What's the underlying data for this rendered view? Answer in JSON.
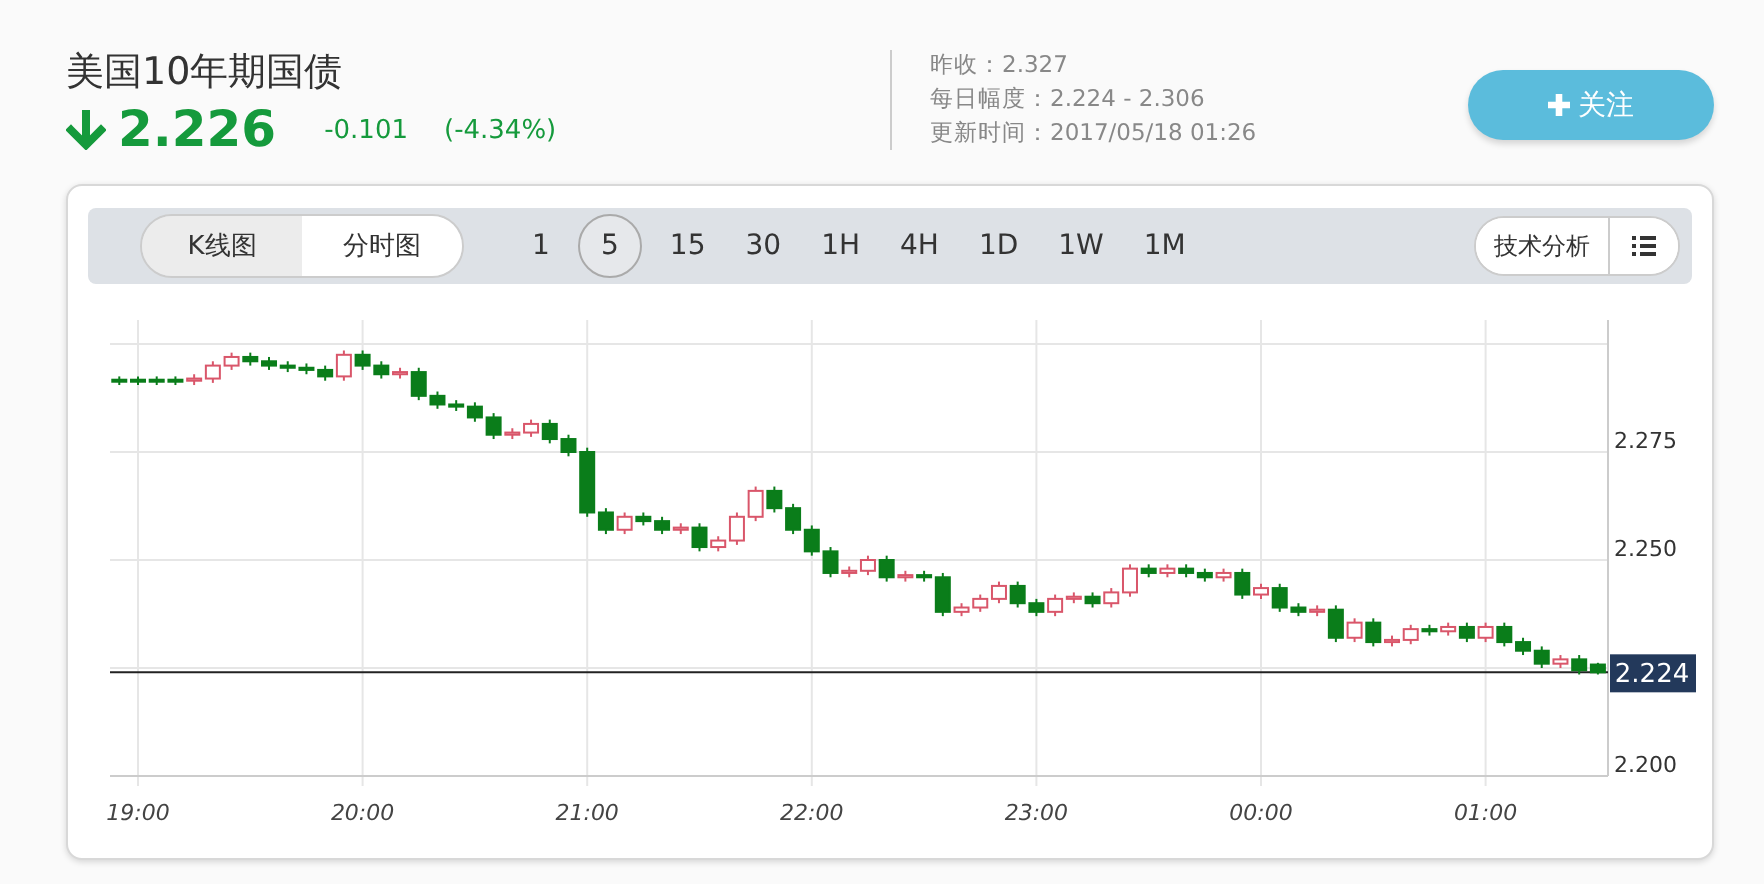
{
  "instrument": {
    "title": "美国10年期国债",
    "falling": true,
    "price": "2.226",
    "change": "-0.101",
    "change_percent": "(-4.34%)"
  },
  "stats": [
    "昨收：2.327",
    "每日幅度：2.224 - 2.306",
    "更新时间：2017/05/18 01:26"
  ],
  "follow_button": {
    "label": "关注"
  },
  "chart_types": [
    {
      "label": "K线图",
      "selected": true
    },
    {
      "label": "分时图",
      "selected": false
    }
  ],
  "periods": [
    {
      "label": "1",
      "selected": false
    },
    {
      "label": "5",
      "selected": true
    },
    {
      "label": "15",
      "selected": false
    },
    {
      "label": "30",
      "selected": false
    },
    {
      "label": "1H",
      "selected": false
    },
    {
      "label": "4H",
      "selected": false
    },
    {
      "label": "1D",
      "selected": false
    },
    {
      "label": "1W",
      "selected": false
    },
    {
      "label": "1M",
      "selected": false
    }
  ],
  "analysis_button": {
    "label": "技术分析"
  },
  "chart": {
    "chart_data": {
      "type": "candlestick",
      "grid": true,
      "categories": [
        null,
        "19:00",
        null,
        null,
        null,
        null,
        null,
        null,
        null,
        null,
        null,
        null,
        null,
        "20:00",
        null,
        null,
        null,
        null,
        null,
        null,
        null,
        null,
        null,
        null,
        null,
        "21:00",
        null,
        null,
        null,
        null,
        null,
        null,
        null,
        null,
        null,
        null,
        null,
        "22:00",
        null,
        null,
        null,
        null,
        null,
        null,
        null,
        null,
        null,
        null,
        null,
        "23:00",
        null,
        null,
        null,
        null,
        null,
        null,
        null,
        null,
        null,
        null,
        null,
        "00:00",
        null,
        null,
        null,
        null,
        null,
        null,
        null,
        null,
        null,
        null,
        null,
        "01:00",
        null,
        null,
        null,
        null,
        null,
        null
      ],
      "ohlc": [
        [
          2.2915,
          2.2925,
          2.2905,
          2.2915
        ],
        [
          2.2915,
          2.2925,
          2.2905,
          2.2915
        ],
        [
          2.2915,
          2.2925,
          2.2905,
          2.2915
        ],
        [
          2.2915,
          2.2925,
          2.2905,
          2.2915
        ],
        [
          2.2915,
          2.293,
          2.2905,
          2.292
        ],
        [
          2.292,
          2.296,
          2.291,
          2.295
        ],
        [
          2.295,
          2.298,
          2.294,
          2.297
        ],
        [
          2.297,
          2.298,
          2.295,
          2.296
        ],
        [
          2.296,
          2.297,
          2.294,
          2.295
        ],
        [
          2.295,
          2.296,
          2.2935,
          2.2945
        ],
        [
          2.2945,
          2.2955,
          2.293,
          2.294
        ],
        [
          2.294,
          2.295,
          2.2915,
          2.2925
        ],
        [
          2.2925,
          2.2985,
          2.2915,
          2.2975
        ],
        [
          2.2975,
          2.2985,
          2.294,
          2.295
        ],
        [
          2.295,
          2.296,
          2.292,
          2.293
        ],
        [
          2.293,
          2.2945,
          2.292,
          2.2935
        ],
        [
          2.2935,
          2.2945,
          2.287,
          2.288
        ],
        [
          2.288,
          2.289,
          2.285,
          2.286
        ],
        [
          2.286,
          2.287,
          2.2845,
          2.2855
        ],
        [
          2.2855,
          2.2865,
          2.282,
          2.283
        ],
        [
          2.283,
          2.284,
          2.278,
          2.279
        ],
        [
          2.279,
          2.2805,
          2.278,
          2.2795
        ],
        [
          2.2795,
          2.2825,
          2.2785,
          2.2815
        ],
        [
          2.2815,
          2.2825,
          2.277,
          2.278
        ],
        [
          2.278,
          2.279,
          2.274,
          2.275
        ],
        [
          2.275,
          2.276,
          2.26,
          2.261
        ],
        [
          2.261,
          2.262,
          2.256,
          2.257
        ],
        [
          2.257,
          2.261,
          2.256,
          2.26
        ],
        [
          2.26,
          2.261,
          2.258,
          2.259
        ],
        [
          2.259,
          2.26,
          2.256,
          2.257
        ],
        [
          2.257,
          2.2585,
          2.256,
          2.2575
        ],
        [
          2.2575,
          2.2585,
          2.252,
          2.253
        ],
        [
          2.253,
          2.2555,
          2.252,
          2.2545
        ],
        [
          2.2545,
          2.261,
          2.2535,
          2.26
        ],
        [
          2.26,
          2.267,
          2.259,
          2.266
        ],
        [
          2.266,
          2.267,
          2.261,
          2.262
        ],
        [
          2.262,
          2.263,
          2.256,
          2.257
        ],
        [
          2.257,
          2.258,
          2.251,
          2.252
        ],
        [
          2.252,
          2.253,
          2.246,
          2.247
        ],
        [
          2.247,
          2.2485,
          2.246,
          2.2475
        ],
        [
          2.2475,
          2.251,
          2.2465,
          2.25
        ],
        [
          2.25,
          2.251,
          2.245,
          2.246
        ],
        [
          2.246,
          2.2475,
          2.245,
          2.2465
        ],
        [
          2.2465,
          2.2475,
          2.245,
          2.246
        ],
        [
          2.246,
          2.247,
          2.237,
          2.238
        ],
        [
          2.238,
          2.24,
          2.237,
          2.239
        ],
        [
          2.239,
          2.242,
          2.238,
          2.241
        ],
        [
          2.241,
          2.245,
          2.24,
          2.244
        ],
        [
          2.244,
          2.245,
          2.239,
          2.24
        ],
        [
          2.24,
          2.241,
          2.237,
          2.238
        ],
        [
          2.238,
          2.242,
          2.237,
          2.241
        ],
        [
          2.241,
          2.2425,
          2.24,
          2.2415
        ],
        [
          2.2415,
          2.2425,
          2.239,
          2.24
        ],
        [
          2.24,
          2.2435,
          2.239,
          2.2425
        ],
        [
          2.2425,
          2.249,
          2.2415,
          2.248
        ],
        [
          2.248,
          2.249,
          2.246,
          2.247
        ],
        [
          2.247,
          2.249,
          2.246,
          2.248
        ],
        [
          2.248,
          2.249,
          2.246,
          2.247
        ],
        [
          2.247,
          2.248,
          2.245,
          2.246
        ],
        [
          2.246,
          2.248,
          2.245,
          2.247
        ],
        [
          2.247,
          2.248,
          2.241,
          2.242
        ],
        [
          2.242,
          2.2445,
          2.241,
          2.2435
        ],
        [
          2.2435,
          2.2445,
          2.238,
          2.239
        ],
        [
          2.239,
          2.24,
          2.237,
          2.238
        ],
        [
          2.238,
          2.2395,
          2.237,
          2.2385
        ],
        [
          2.2385,
          2.2395,
          2.231,
          2.232
        ],
        [
          2.232,
          2.2365,
          2.231,
          2.2355
        ],
        [
          2.2355,
          2.2365,
          2.23,
          2.231
        ],
        [
          2.231,
          2.2325,
          2.23,
          2.2315
        ],
        [
          2.2315,
          2.235,
          2.2305,
          2.234
        ],
        [
          2.234,
          2.235,
          2.2325,
          2.2335
        ],
        [
          2.2335,
          2.2355,
          2.2325,
          2.2345
        ],
        [
          2.2345,
          2.2355,
          2.231,
          2.232
        ],
        [
          2.232,
          2.2355,
          2.231,
          2.2345
        ],
        [
          2.2345,
          2.2355,
          2.23,
          2.231
        ],
        [
          2.231,
          2.232,
          2.228,
          2.229
        ],
        [
          2.229,
          2.23,
          2.225,
          2.226
        ],
        [
          2.226,
          2.228,
          2.225,
          2.227
        ],
        [
          2.227,
          2.228,
          2.2235,
          2.2245
        ],
        [
          2.2258,
          2.2262,
          2.2235,
          2.224
        ]
      ],
      "ylim": [
        2.2,
        2.3
      ],
      "yticks": [
        {
          "value": 2.275,
          "label": "2.275"
        },
        {
          "value": 2.25,
          "label": "2.250"
        },
        {
          "value": 2.2,
          "label": "2.200"
        }
      ],
      "ref_lines": [
        {
          "axis": "y",
          "value": 2.224,
          "label": "2.224"
        }
      ]
    }
  }
}
